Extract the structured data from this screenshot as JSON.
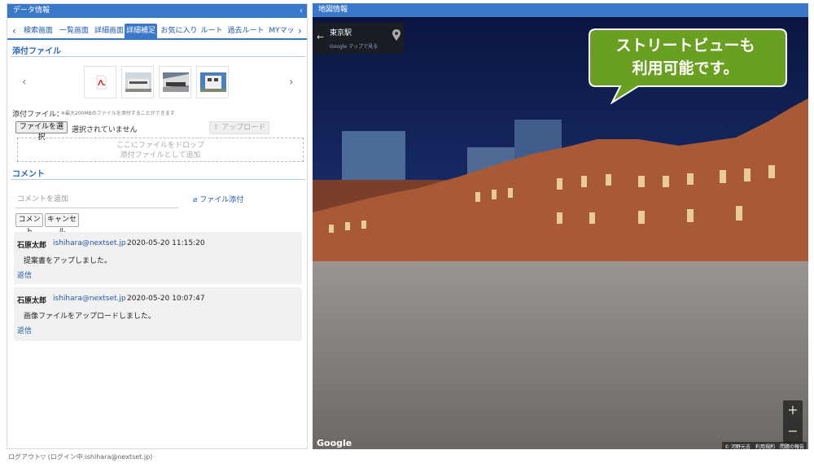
{
  "left_panel": {
    "title": "データ情報",
    "collapse_icon": "chevron-left-icon"
  },
  "tabs": [
    "検索画面",
    "一覧画面",
    "詳細画面",
    "詳細補足",
    "お気に入り",
    "ルート",
    "過去ルート",
    "MYマッ"
  ],
  "active_tab": "詳細補足",
  "attachments": {
    "title": "添付ファイル",
    "label": "添付ファイル：",
    "note": "※最大200MBのファイルを添付することができます",
    "choose_button": "ファイルを選択",
    "no_file": "選択されていません",
    "upload_button": "アップロード",
    "drop_line1": "ここにファイルをドロップ",
    "drop_line2": "添付ファイルとして追加",
    "thumbnails": [
      "pdf-icon",
      "building-photo",
      "building-photo",
      "building-photo"
    ]
  },
  "comments": {
    "title": "コメント",
    "placeholder": "コメントを追加",
    "attach_link": "ファイル添付",
    "comment_button": "コメント",
    "cancel_button": "キャンセル",
    "items": [
      {
        "author": "石原太郎",
        "email": "ishihara@nextset.jp",
        "datetime": "2020-05-20 11:15:20",
        "text": "提案書をアップしました。",
        "reply": "返信"
      },
      {
        "author": "石原太郎",
        "email": "ishihara@nextset.jp",
        "datetime": "2020-05-20 10:07:47",
        "text": "画像ファイルをアップロードしました。",
        "reply": "返信"
      }
    ]
  },
  "footer": {
    "logout": "ログアウト▽",
    "login_info": "(ログイン中:ishihara@nextset.jp)"
  },
  "right_panel": {
    "title": "地図情報"
  },
  "streetview": {
    "location": "東京駅",
    "maps_link": "Google マップで見る",
    "callout_line1": "ストリートビューも",
    "callout_line2": "利用可能です。",
    "zoom_in": "+",
    "zoom_out": "−",
    "logo": "Google",
    "copyright": "© 河野元吉　利用規約　問題の報告"
  },
  "colors": {
    "accent": "#3a78c9",
    "link": "#2258a8",
    "callout": "#6aa021"
  }
}
